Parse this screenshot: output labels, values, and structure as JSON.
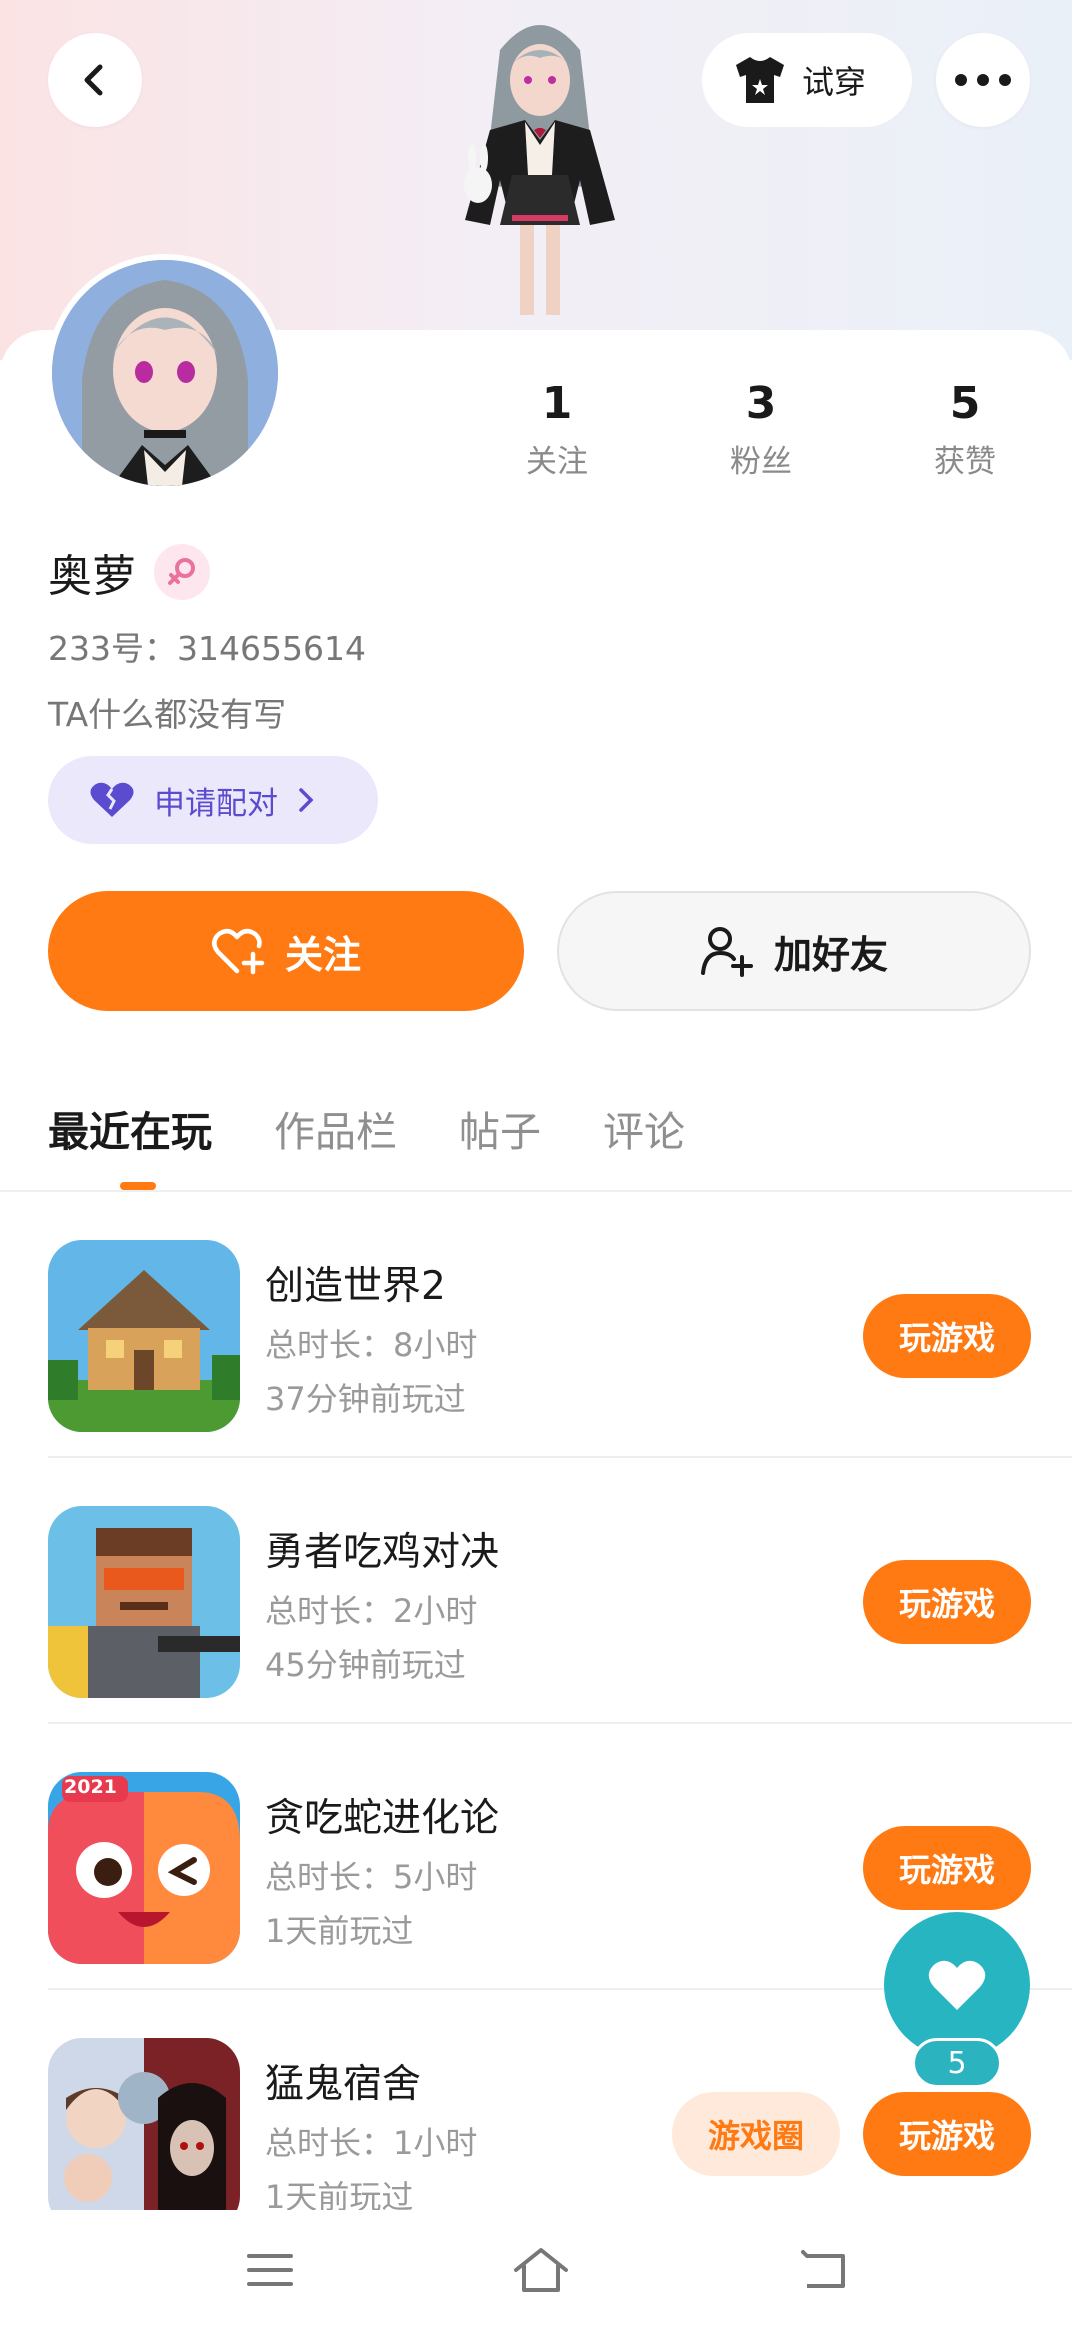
{
  "header": {
    "back_icon": "chevron-left-icon",
    "tryon_label": "试穿",
    "tryon_icon": "tshirt-icon",
    "more_icon": "more-dots-icon"
  },
  "profile": {
    "stats": [
      {
        "value": "1",
        "label": "关注"
      },
      {
        "value": "3",
        "label": "粉丝"
      },
      {
        "value": "5",
        "label": "获赞"
      }
    ],
    "nickname": "奥萝",
    "gender_icon": "female-symbol-icon",
    "user_id": "233号：314655614",
    "bio": "TA什么都没有写",
    "pair_label": "申请配对",
    "follow_label": "关注",
    "add_friend_label": "加好友"
  },
  "tabs": [
    {
      "label": "最近在玩",
      "active": true
    },
    {
      "label": "作品栏",
      "active": false
    },
    {
      "label": "帖子",
      "active": false
    },
    {
      "label": "评论",
      "active": false
    }
  ],
  "games": [
    {
      "title": "创造世界2",
      "duration": "总时长：8小时",
      "last_played": "37分钟前玩过",
      "play_label": "玩游戏"
    },
    {
      "title": "勇者吃鸡对决",
      "duration": "总时长：2小时",
      "last_played": "45分钟前玩过",
      "play_label": "玩游戏"
    },
    {
      "title": "贪吃蛇进化论",
      "duration": "总时长：5小时",
      "last_played": "1天前玩过",
      "play_label": "玩游戏",
      "icon_badge": "2021"
    },
    {
      "title": "猛鬼宿舍",
      "duration": "总时长：1小时",
      "last_played": "1天前玩过",
      "play_label": "玩游戏",
      "circle_label": "游戏圈"
    }
  ],
  "like_fab": {
    "count": "5",
    "icon": "heart-icon"
  },
  "colors": {
    "accent": "#ff7a12",
    "teal": "#27b5c2",
    "purple": "#5b4ccf"
  },
  "system_nav": [
    "menu-icon",
    "home-icon",
    "back-icon"
  ]
}
